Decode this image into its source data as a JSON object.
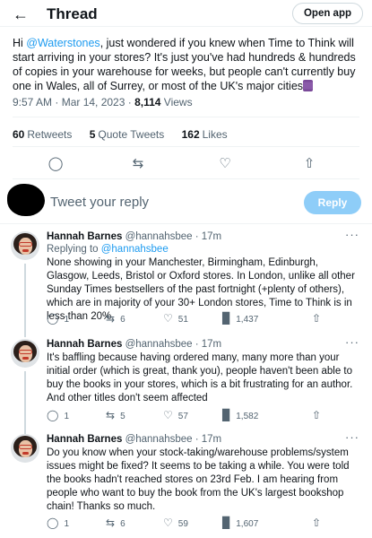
{
  "header": {
    "title": "Thread",
    "open_app": "Open app",
    "back_icon": "arrow-left-icon"
  },
  "tweet": {
    "prefix": "Hi ",
    "mention": "@Waterstones",
    "body": ", just wondered if you knew when Time to Think will start arriving in your stores? It's just you've had hundreds & hundreds of copies in your warehouse for weeks, but people can't currently buy one in Wales, all of Surrey, or most of the UK's major cities",
    "time": "9:57 AM · Mar 14, 2023 · ",
    "views_count": "8,114",
    "views_label": " Views",
    "retweets_count": "60",
    "retweets_label": "Retweets",
    "quotes_count": "5",
    "quotes_label": "Quote Tweets",
    "likes_count": "162",
    "likes_label": "Likes"
  },
  "composer": {
    "placeholder": "Tweet your reply",
    "button": "Reply"
  },
  "replies": [
    {
      "name": "Hannah Barnes",
      "handle": "@hannahsbee · 17m",
      "replying_prefix": "Replying to ",
      "replying_to": "@hannahsbee",
      "text": "None showing in your Manchester, Birmingham, Edinburgh, Glasgow, Leeds, Bristol or Oxford stores. In London, unlike all other Sunday Times bestsellers of the past fortnight (+plenty of others), which are in majority of your 30+ London stores, Time to Think is in less than 20%.",
      "replies": "1",
      "retweets": "6",
      "likes": "51",
      "views": "1,437"
    },
    {
      "name": "Hannah Barnes",
      "handle": "@hannahsbee · 17m",
      "text": "It's baffling because having ordered many, many more than your initial order (which is great, thank you), people haven't been able to buy the books in your stores, which is a bit frustrating for an author. And other titles don't seem affected",
      "replies": "1",
      "retweets": "5",
      "likes": "57",
      "views": "1,582"
    },
    {
      "name": "Hannah Barnes",
      "handle": "@hannahsbee · 17m",
      "text": "Do you know when your stock-taking/warehouse problems/system issues might be fixed? It seems to be taking a while. You were told the books hadn't reached stores on 23rd Feb. I am hearing from people who want to buy the book from the UK's largest bookshop chain! Thanks so much.",
      "replies": "1",
      "retweets": "6",
      "likes": "59",
      "views": "1,607"
    }
  ],
  "colors": {
    "accent": "#1d9bf0",
    "reply_button": "#8ecdf8",
    "muted": "#536471"
  }
}
